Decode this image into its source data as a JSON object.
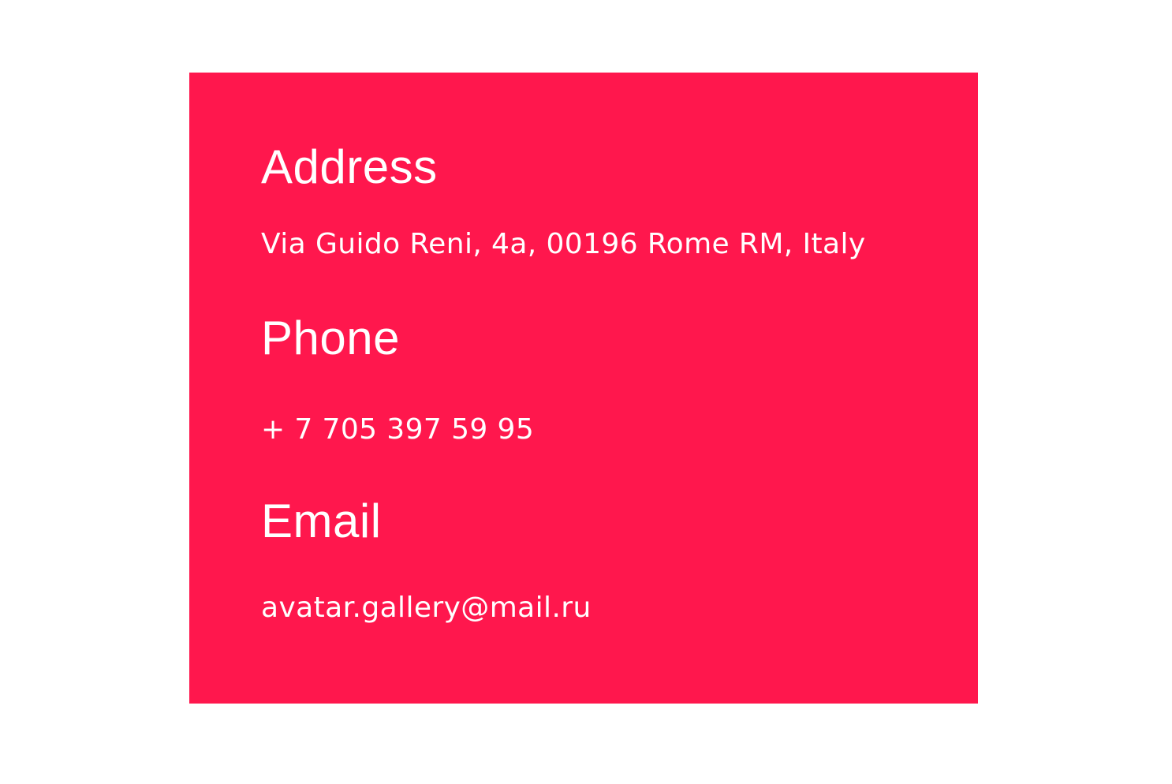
{
  "contact": {
    "address": {
      "heading": "Address",
      "value": "Via Guido Reni, 4a, 00196 Rome RM, Italy"
    },
    "phone": {
      "heading": "Phone",
      "value": "+ 7 705 397 59 95"
    },
    "email": {
      "heading": "Email",
      "value": "avatar.gallery@mail.ru"
    }
  },
  "colors": {
    "card_background": "#ff174d",
    "text": "#ffffff",
    "page_background": "#ffffff"
  }
}
